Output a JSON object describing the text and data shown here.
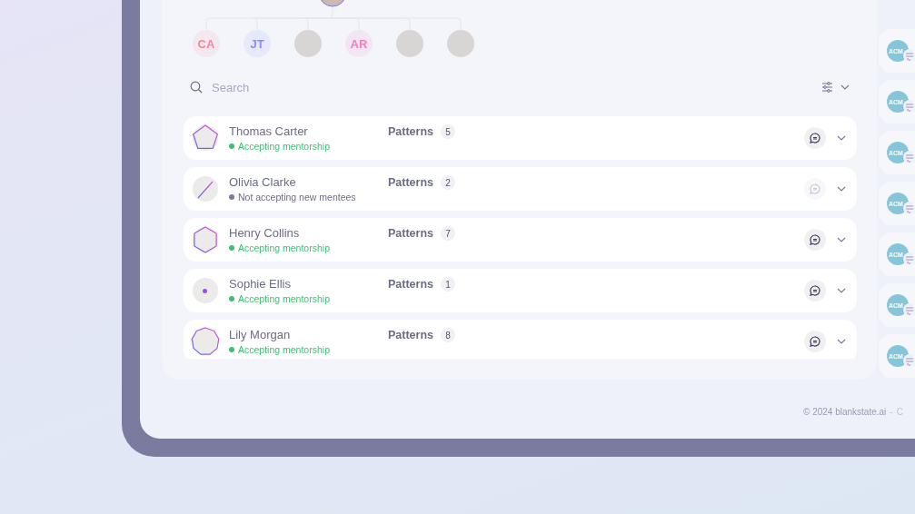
{
  "tree": {
    "children": [
      {
        "kind": "initials",
        "initials": "CA",
        "color": "#f08a9a"
      },
      {
        "kind": "initials",
        "initials": "JT",
        "color": "#8a8ef0"
      },
      {
        "kind": "photo"
      },
      {
        "kind": "initials",
        "initials": "AR",
        "color": "#ee7fbf"
      },
      {
        "kind": "photo"
      },
      {
        "kind": "photo"
      }
    ]
  },
  "search": {
    "placeholder": "Search"
  },
  "mentors": [
    {
      "name": "Thomas Carter",
      "accepting": true,
      "status": "Accepting mentorship",
      "patterns_label": "Patterns",
      "patterns_count": "5",
      "kind": "pentagon",
      "chat_enabled": true
    },
    {
      "name": "Olivia Clarke",
      "accepting": false,
      "status": "Not accepting new mentees",
      "patterns_label": "Patterns",
      "patterns_count": "2",
      "kind": "line",
      "chat_enabled": false
    },
    {
      "name": "Henry Collins",
      "accepting": true,
      "status": "Accepting mentorship",
      "patterns_label": "Patterns",
      "patterns_count": "7",
      "kind": "hexagon",
      "chat_enabled": true
    },
    {
      "name": "Sophie Ellis",
      "accepting": true,
      "status": "Accepting mentorship",
      "patterns_label": "Patterns",
      "patterns_count": "1",
      "kind": "dot",
      "chat_enabled": true
    },
    {
      "name": "Lily Morgan",
      "accepting": true,
      "status": "Accepting mentorship",
      "patterns_label": "Patterns",
      "patterns_count": "8",
      "kind": "nonagon",
      "chat_enabled": true
    }
  ],
  "side_cards": [
    {
      "logo": "ACM"
    },
    {
      "logo": "ACM"
    },
    {
      "logo": "ACM"
    },
    {
      "logo": "ACM"
    },
    {
      "logo": "ACM"
    },
    {
      "logo": "ACM"
    },
    {
      "logo": "ACM"
    }
  ],
  "footer": {
    "copyright": "© 2024 blankstate.ai",
    "separator": "-",
    "link": "C"
  }
}
